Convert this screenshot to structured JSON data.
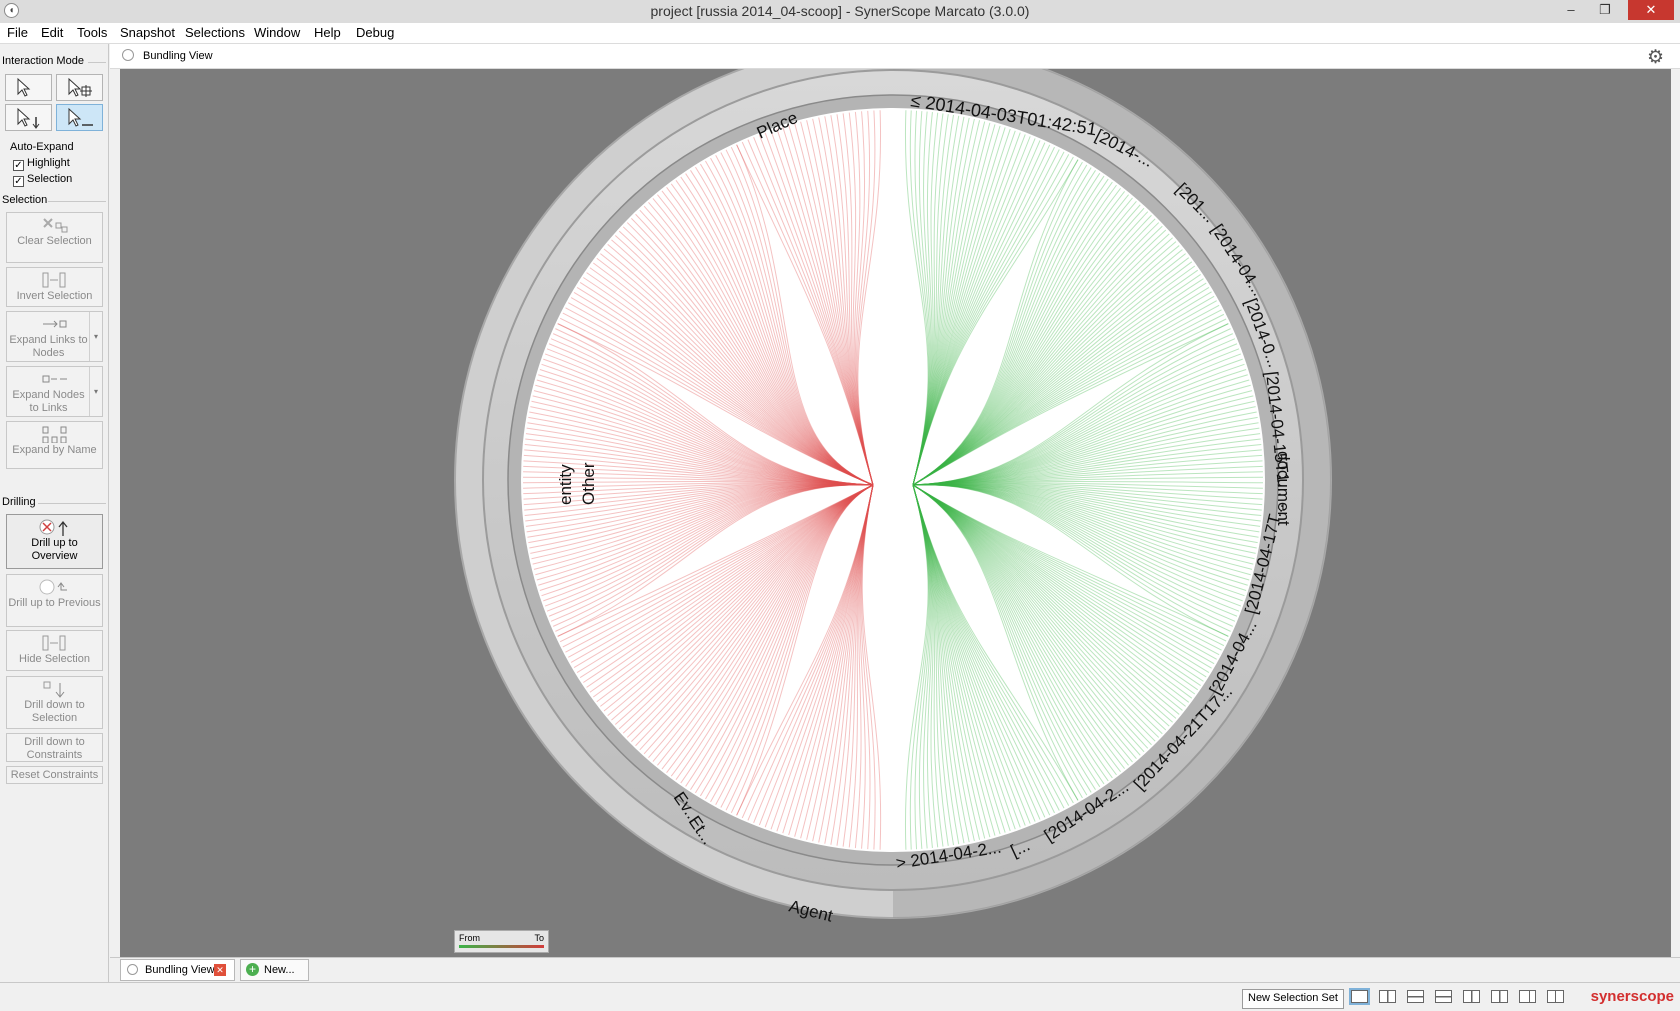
{
  "window": {
    "title": "project [russia 2014_04-scoop] - SynerScope Marcato (3.0.0)",
    "controls": [
      "–",
      "❐",
      "✕"
    ]
  },
  "menu": [
    "File",
    "Edit",
    "Tools",
    "Snapshot",
    "Selections",
    "Window",
    "Help",
    "Debug"
  ],
  "left_panel": {
    "interaction_mode_label": "Interaction Mode",
    "auto_expand_label": "Auto-Expand",
    "highlight_label": "Highlight",
    "selection_check_label": "Selection",
    "selection_section_label": "Selection",
    "buttons": {
      "clear_selection": "Clear Selection",
      "invert_selection": "Invert Selection",
      "expand_links_to_nodes": "Expand Links to Nodes",
      "expand_nodes_to_links": "Expand Nodes to Links",
      "expand_by_name": "Expand by Name"
    },
    "drilling_label": "Drilling",
    "drilling": {
      "drill_up_overview": "Drill up to Overview",
      "drill_up_previous": "Drill up to Previous",
      "hide_selection": "Hide Selection",
      "drill_down_selection": "Drill down to Selection",
      "drill_down_constraints": "Drill down to Constraints",
      "reset_constraints": "Reset Constraints"
    }
  },
  "view": {
    "header_title": "Bundling View",
    "legend_from": "From",
    "legend_to": "To",
    "ring_labels": {
      "place": "Place",
      "other": "Other",
      "entity": "entity",
      "ev": "Ev...",
      "et": "Et...",
      "agent": "Agent",
      "document": "document",
      "d1": "≤ 2014-04-03T01:42:51",
      "d2": "[2014-...",
      "d3": "[201...",
      "d4": "[2014-04...",
      "d5": "[2014-0...",
      "d6": "[2014-04-15T1...",
      "d7": "[2014-04-17T...",
      "d8": "[2014-04...",
      "d9": "[2014-04-21T17...",
      "d10": "[2014-04-2...",
      "d11": "[...",
      "d12": "> 2014-04-2..."
    },
    "colors": {
      "from": "#3bb449",
      "to": "#e05050"
    }
  },
  "tabs": [
    "Bundling View",
    "New..."
  ],
  "status": {
    "new_selection_set": "New Selection Set",
    "brand": "synerscope"
  }
}
